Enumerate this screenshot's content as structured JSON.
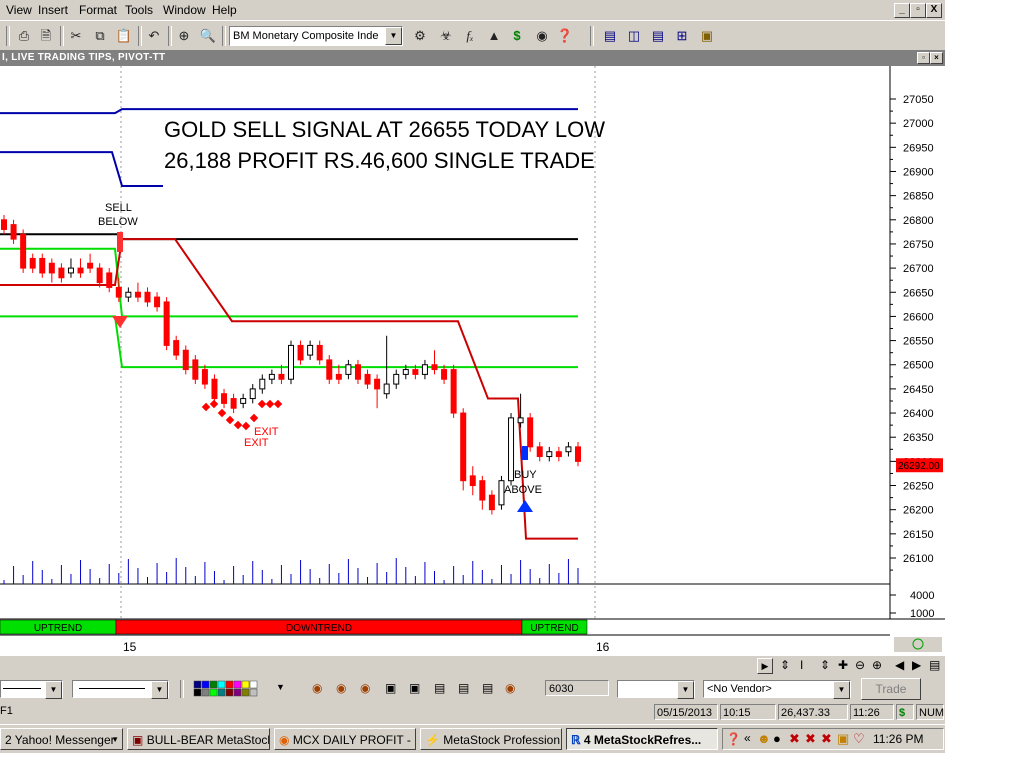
{
  "menu": [
    "View",
    "Insert",
    "Format",
    "Tools",
    "Window",
    "Help"
  ],
  "window_controls": {
    "minimize": "_",
    "restore": "▫",
    "close": "X"
  },
  "toolbar": {
    "security_select": "BM Monetary Composite Inde",
    "icons": [
      "print-icon",
      "print-preview-icon",
      "cut-icon",
      "copy-icon",
      "paste-icon",
      "undo-icon",
      "crosshair-icon",
      "zoom-icon",
      "expert-icon",
      "indicator-icon",
      "formula-icon",
      "system-tester-icon",
      "dollar-icon",
      "explorer-icon",
      "help-icon",
      "tile-icon",
      "vertical-split-icon",
      "horizontal-split-icon",
      "grid-icon",
      "layout-icon"
    ]
  },
  "chart": {
    "window_title": "I, LIVE TRADING TIPS, PIVOT-TT",
    "headline_line1": "GOLD SELL SIGNAL AT 26655 TODAY LOW",
    "headline_line2": "26,188 PROFIT RS.46,600 SINGLE TRADE",
    "annotations": {
      "sell_below_1": "SELL",
      "sell_below_2": "BELOW",
      "exit_1": "EXIT",
      "exit_2": "EXIT",
      "buy_above_1": "BUY",
      "buy_above_2": "ABOVE"
    },
    "price_axis_labels": [
      "27050",
      "27000",
      "26950",
      "26900",
      "26850",
      "26800",
      "26750",
      "26700",
      "26650",
      "26600",
      "26550",
      "26500",
      "26450",
      "26400",
      "26350",
      "26300",
      "26250",
      "26200",
      "26150",
      "26100"
    ],
    "current_price_label": "26292.00",
    "volume_axis_labels": [
      "4000",
      "1000"
    ],
    "trend_bands": [
      {
        "label": "UPTREND",
        "color": "#00e000"
      },
      {
        "label": "DOWNTREND",
        "color": "#ff0000"
      },
      {
        "label": "UPTREND",
        "color": "#00e000"
      }
    ],
    "date_labels": [
      "15",
      "16"
    ],
    "colors": {
      "bull": "#ffffff",
      "bear": "#ff0000",
      "resistance_blue": "#0000aa",
      "support_green": "#00dd00",
      "stop_red": "#cc0000",
      "black_level": "#000000"
    }
  },
  "chart_data": {
    "type": "candlestick",
    "title": "GOLD SELL SIGNAL AT 26655 TODAY LOW 26,188 PROFIT RS.46,600 SINGLE TRADE",
    "ylim": [
      26050,
      27100
    ],
    "levels": {
      "blue_upper": 27025,
      "blue_lower_early": 26940,
      "blue_lower_late": 26870,
      "black": 26760,
      "green_upper": 26600,
      "green_lower": 26495,
      "red_lower": 26140
    },
    "current_price": 26292.0,
    "candles": [
      {
        "o": 26800,
        "c": 26780,
        "h": 26810,
        "l": 26770
      },
      {
        "o": 26790,
        "c": 26760,
        "h": 26800,
        "l": 26750
      },
      {
        "o": 26770,
        "c": 26700,
        "h": 26780,
        "l": 26690
      },
      {
        "o": 26720,
        "c": 26700,
        "h": 26730,
        "l": 26690
      },
      {
        "o": 26720,
        "c": 26690,
        "h": 26730,
        "l": 26680
      },
      {
        "o": 26710,
        "c": 26690,
        "h": 26720,
        "l": 26670
      },
      {
        "o": 26700,
        "c": 26680,
        "h": 26710,
        "l": 26670
      },
      {
        "o": 26690,
        "c": 26700,
        "h": 26720,
        "l": 26680
      },
      {
        "o": 26700,
        "c": 26690,
        "h": 26720,
        "l": 26680
      },
      {
        "o": 26710,
        "c": 26700,
        "h": 26730,
        "l": 26690
      },
      {
        "o": 26700,
        "c": 26670,
        "h": 26710,
        "l": 26660
      },
      {
        "o": 26690,
        "c": 26660,
        "h": 26700,
        "l": 26650
      },
      {
        "o": 26660,
        "c": 26640,
        "h": 26680,
        "l": 26630
      },
      {
        "o": 26640,
        "c": 26650,
        "h": 26660,
        "l": 26630
      },
      {
        "o": 26650,
        "c": 26640,
        "h": 26670,
        "l": 26630
      },
      {
        "o": 26650,
        "c": 26630,
        "h": 26660,
        "l": 26620
      },
      {
        "o": 26640,
        "c": 26620,
        "h": 26650,
        "l": 26610
      },
      {
        "o": 26630,
        "c": 26540,
        "h": 26640,
        "l": 26530
      },
      {
        "o": 26550,
        "c": 26520,
        "h": 26560,
        "l": 26510
      },
      {
        "o": 26530,
        "c": 26490,
        "h": 26540,
        "l": 26480
      },
      {
        "o": 26510,
        "c": 26470,
        "h": 26520,
        "l": 26460
      },
      {
        "o": 26490,
        "c": 26460,
        "h": 26500,
        "l": 26450
      },
      {
        "o": 26470,
        "c": 26430,
        "h": 26480,
        "l": 26420
      },
      {
        "o": 26440,
        "c": 26420,
        "h": 26450,
        "l": 26410
      },
      {
        "o": 26430,
        "c": 26410,
        "h": 26440,
        "l": 26400
      },
      {
        "o": 26420,
        "c": 26430,
        "h": 26440,
        "l": 26410
      },
      {
        "o": 26430,
        "c": 26450,
        "h": 26460,
        "l": 26420
      },
      {
        "o": 26450,
        "c": 26470,
        "h": 26480,
        "l": 26440
      },
      {
        "o": 26470,
        "c": 26480,
        "h": 26490,
        "l": 26460
      },
      {
        "o": 26480,
        "c": 26470,
        "h": 26500,
        "l": 26460
      },
      {
        "o": 26470,
        "c": 26540,
        "h": 26550,
        "l": 26460
      },
      {
        "o": 26540,
        "c": 26510,
        "h": 26550,
        "l": 26500
      },
      {
        "o": 26520,
        "c": 26540,
        "h": 26550,
        "l": 26510
      },
      {
        "o": 26540,
        "c": 26510,
        "h": 26550,
        "l": 26500
      },
      {
        "o": 26510,
        "c": 26470,
        "h": 26520,
        "l": 26460
      },
      {
        "o": 26480,
        "c": 26470,
        "h": 26500,
        "l": 26460
      },
      {
        "o": 26480,
        "c": 26500,
        "h": 26510,
        "l": 26470
      },
      {
        "o": 26500,
        "c": 26470,
        "h": 26510,
        "l": 26460
      },
      {
        "o": 26480,
        "c": 26460,
        "h": 26490,
        "l": 26450
      },
      {
        "o": 26470,
        "c": 26450,
        "h": 26480,
        "l": 26410
      },
      {
        "o": 26440,
        "c": 26460,
        "h": 26560,
        "l": 26430
      },
      {
        "o": 26460,
        "c": 26480,
        "h": 26490,
        "l": 26450
      },
      {
        "o": 26480,
        "c": 26490,
        "h": 26500,
        "l": 26470
      },
      {
        "o": 26490,
        "c": 26480,
        "h": 26500,
        "l": 26470
      },
      {
        "o": 26480,
        "c": 26500,
        "h": 26510,
        "l": 26470
      },
      {
        "o": 26500,
        "c": 26490,
        "h": 26530,
        "l": 26480
      },
      {
        "o": 26490,
        "c": 26470,
        "h": 26500,
        "l": 26460
      },
      {
        "o": 26490,
        "c": 26400,
        "h": 26500,
        "l": 26390
      },
      {
        "o": 26400,
        "c": 26260,
        "h": 26410,
        "l": 26240
      },
      {
        "o": 26270,
        "c": 26250,
        "h": 26290,
        "l": 26230
      },
      {
        "o": 26260,
        "c": 26220,
        "h": 26270,
        "l": 26200
      },
      {
        "o": 26230,
        "c": 26200,
        "h": 26240,
        "l": 26190
      },
      {
        "o": 26210,
        "c": 26260,
        "h": 26270,
        "l": 26200
      },
      {
        "o": 26260,
        "c": 26390,
        "h": 26400,
        "l": 26250
      },
      {
        "o": 26380,
        "c": 26390,
        "h": 26440,
        "l": 26370
      },
      {
        "o": 26390,
        "c": 26330,
        "h": 26400,
        "l": 26320
      },
      {
        "o": 26330,
        "c": 26310,
        "h": 26340,
        "l": 26300
      },
      {
        "o": 26310,
        "c": 26320,
        "h": 26330,
        "l": 26300
      },
      {
        "o": 26320,
        "c": 26310,
        "h": 26330,
        "l": 26300
      },
      {
        "o": 26320,
        "c": 26330,
        "h": 26340,
        "l": 26310
      },
      {
        "o": 26330,
        "c": 26300,
        "h": 26340,
        "l": 26290
      }
    ]
  },
  "controls": {
    "value_field": "6030",
    "vendor_select": "<No Vendor>",
    "trade_button": "Trade"
  },
  "status": {
    "left": "F1",
    "date": "05/15/2013",
    "time": "10:15",
    "price": "26,437.33",
    "clock": "11:26",
    "dollar": "$",
    "num": "NUM"
  },
  "taskbar": {
    "items": [
      {
        "label": "2 Yahoo! Messenger",
        "active": false
      },
      {
        "label": "BULL-BEAR MetaStock",
        "active": false
      },
      {
        "label": "MCX DAILY PROFIT - ...",
        "active": false
      },
      {
        "label": "MetaStock Profession...",
        "active": false
      },
      {
        "label": "4 MetaStockRefres...",
        "active": true
      }
    ],
    "tray_time": "11:26 PM"
  }
}
